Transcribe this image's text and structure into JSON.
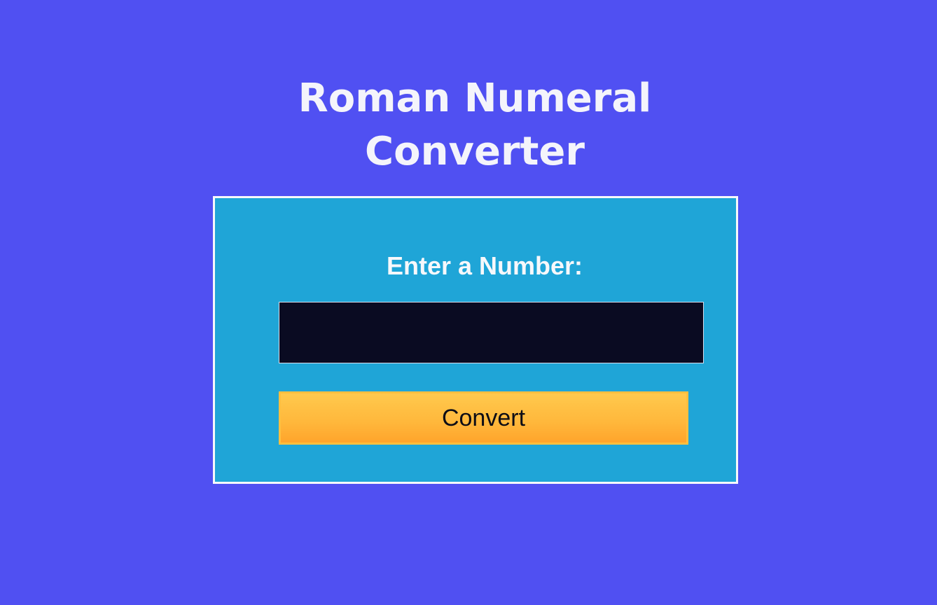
{
  "page": {
    "title_line_1": "Roman Numeral",
    "title_line_2": "Converter"
  },
  "form": {
    "label": "Enter a Number:",
    "input_value": "",
    "convert_label": "Convert"
  },
  "colors": {
    "background": "#5050f2",
    "card": "#1fa5d7",
    "input": "#0a0b22",
    "button": "#ffb73b"
  }
}
